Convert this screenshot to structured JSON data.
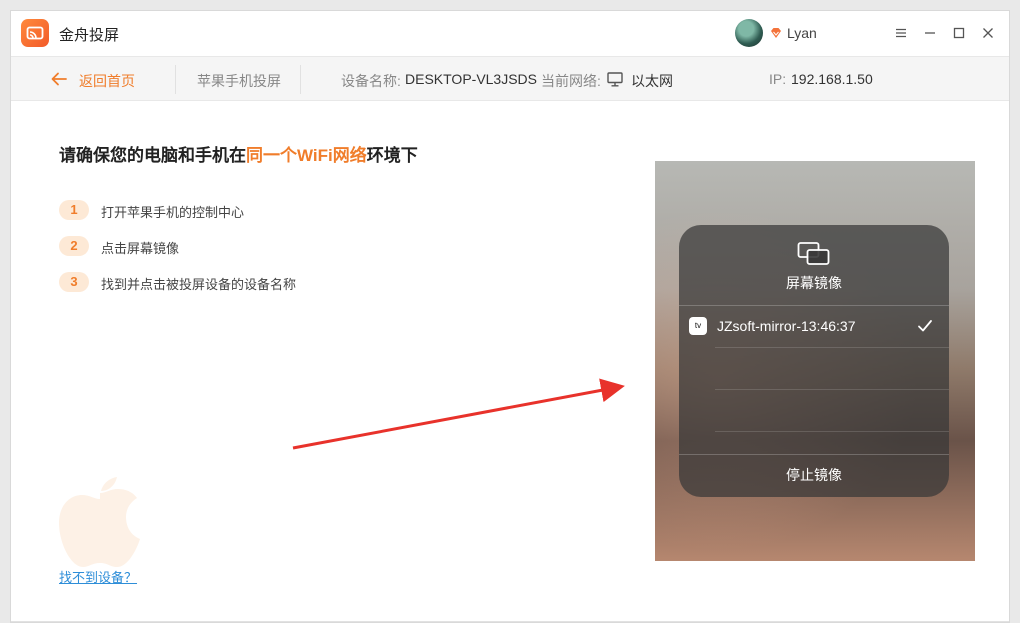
{
  "app": {
    "title": "金舟投屏"
  },
  "user": {
    "name": "Lyan"
  },
  "window_controls": [
    "menu-icon",
    "minimize-icon",
    "maximize-icon",
    "close-icon"
  ],
  "toolbar": {
    "back_label": "返回首页",
    "mode_label": "苹果手机投屏",
    "device_label": "设备名称:",
    "device_value": "DESKTOP-VL3JSDS",
    "network_label": "当前网络:",
    "network_value": "以太网",
    "ip_label": "IP:",
    "ip_value": "192.168.1.50"
  },
  "main": {
    "heading_prefix": "请确保您的电脑和手机在",
    "heading_highlight": "同一个WiFi网络",
    "heading_suffix": "环境下",
    "steps": [
      {
        "num": "1",
        "text": "打开苹果手机的控制中心"
      },
      {
        "num": "2",
        "text": "点击屏幕镜像"
      },
      {
        "num": "3",
        "text": "找到并点击被投屏设备的设备名称"
      }
    ],
    "help_link": "找不到设备？"
  },
  "phone": {
    "panel_title": "屏幕镜像",
    "tv_badge": "tv",
    "device_name": "JZsoft-mirror-13:46:37",
    "stop_label": "停止镜像"
  },
  "colors": {
    "accent": "#f07d2b",
    "step_badge_bg": "#fde9d6",
    "link": "#2e8ed8",
    "arrow": "#e8322b"
  }
}
